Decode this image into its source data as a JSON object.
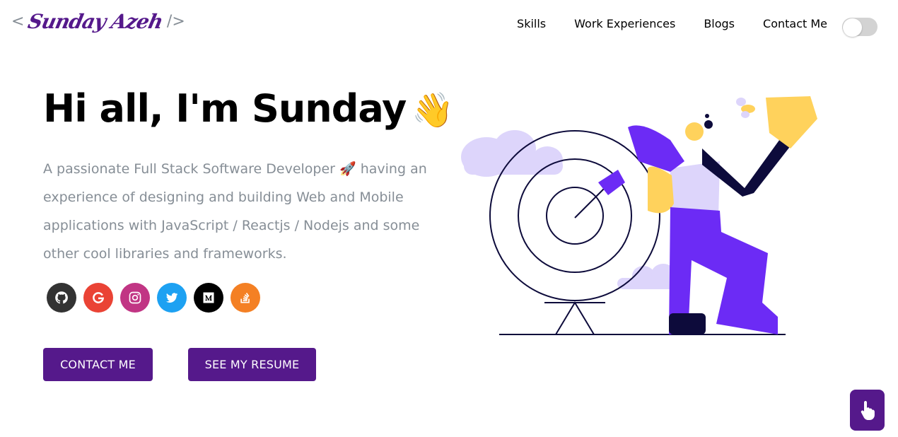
{
  "logo": {
    "open_bracket": "<",
    "signature": "Sunday Azeh",
    "close_bracket": "/>",
    "accent": "#55198b"
  },
  "nav": {
    "items": [
      {
        "label": "Skills"
      },
      {
        "label": "Work Experiences"
      },
      {
        "label": "Blogs"
      },
      {
        "label": "Contact Me"
      }
    ],
    "theme_toggle": {
      "state": "off"
    }
  },
  "hero": {
    "greeting": "Hi all, I'm Sunday",
    "greeting_emoji": "👋",
    "subtitle": "A passionate Full Stack Software Developer 🚀 having an experience of designing and building Web and Mobile applications with JavaScript / Reactjs / Nodejs and some other cool libraries and frameworks."
  },
  "socials": [
    {
      "name": "github-icon",
      "color": "#333333"
    },
    {
      "name": "google-icon",
      "color": "#ea4335"
    },
    {
      "name": "instagram-icon",
      "color": "#c13584"
    },
    {
      "name": "twitter-icon",
      "color": "#1da1f2"
    },
    {
      "name": "medium-icon",
      "color": "#000000"
    },
    {
      "name": "stack-overflow-icon",
      "color": "#f48024"
    }
  ],
  "buttons": {
    "contact": "CONTACT ME",
    "resume": "SEE MY RESUME"
  },
  "colors": {
    "primary": "#55198b",
    "text_muted": "#868e96",
    "illustration_purple": "#6C2BF5",
    "illustration_lavender": "#ddd5fb",
    "illustration_yellow": "#ffd25c"
  }
}
